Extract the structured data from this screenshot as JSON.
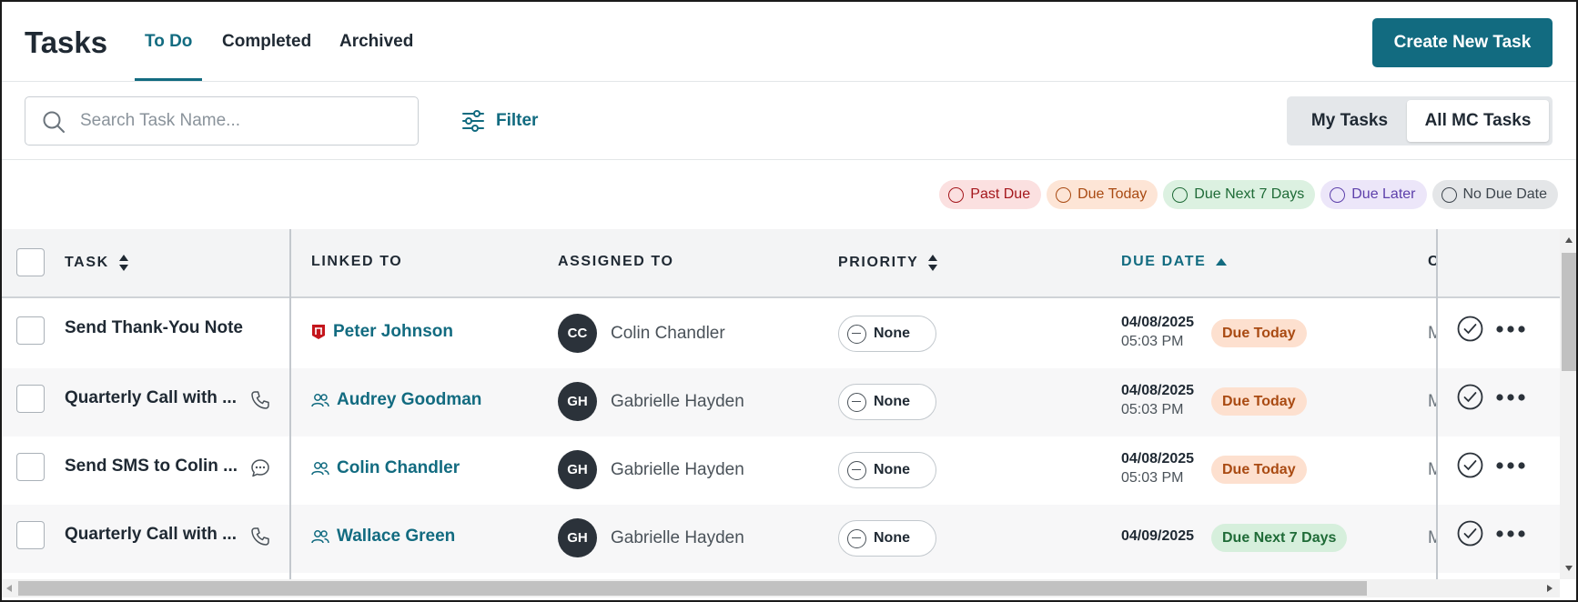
{
  "header": {
    "title": "Tasks",
    "tabs": [
      {
        "label": "To Do",
        "active": true
      },
      {
        "label": "Completed",
        "active": false
      },
      {
        "label": "Archived",
        "active": false
      }
    ],
    "create_button": "Create New Task"
  },
  "toolbar": {
    "search_placeholder": "Search Task Name...",
    "filter_label": "Filter",
    "segment": {
      "my_tasks": "My Tasks",
      "all_tasks": "All MC Tasks",
      "selected": "All MC Tasks"
    }
  },
  "legend": {
    "past_due": "Past Due",
    "due_today": "Due Today",
    "due_next_7": "Due Next 7 Days",
    "due_later": "Due Later",
    "no_due": "No Due Date"
  },
  "table": {
    "columns": {
      "task": "TASK",
      "linked_to": "LINKED TO",
      "assigned_to": "ASSIGNED TO",
      "priority": "PRIORITY",
      "due_date": "DUE DATE",
      "next_partial": "C"
    },
    "rows": [
      {
        "task": "Send Thank-You Note",
        "task_icon": "",
        "linked": "Peter Johnson",
        "linked_icon": "shield-badge-icon",
        "initials": "CC",
        "assignee": "Colin Chandler",
        "priority": "None",
        "date": "04/08/2025",
        "time": "05:03 PM",
        "status": "Due Today",
        "next_col": "M"
      },
      {
        "task": "Quarterly Call with ...",
        "task_icon": "phone-icon",
        "linked": "Audrey Goodman",
        "linked_icon": "people-icon",
        "initials": "GH",
        "assignee": "Gabrielle Hayden",
        "priority": "None",
        "date": "04/08/2025",
        "time": "05:03 PM",
        "status": "Due Today",
        "next_col": "M"
      },
      {
        "task": "Send SMS to Colin ...",
        "task_icon": "chat-bubble-icon",
        "linked": "Colin Chandler",
        "linked_icon": "people-icon",
        "initials": "GH",
        "assignee": "Gabrielle Hayden",
        "priority": "None",
        "date": "04/08/2025",
        "time": "05:03 PM",
        "status": "Due Today",
        "next_col": "M"
      },
      {
        "task": "Quarterly Call with ...",
        "task_icon": "phone-icon",
        "linked": "Wallace Green",
        "linked_icon": "people-icon",
        "initials": "GH",
        "assignee": "Gabrielle Hayden",
        "priority": "None",
        "date": "04/09/2025",
        "time": "",
        "status": "Due Next 7 Days",
        "next_col": "M"
      }
    ]
  },
  "colors": {
    "accent": "#126b80",
    "due_today_bg": "#fde0cf",
    "due_next_bg": "#d6efdc"
  }
}
